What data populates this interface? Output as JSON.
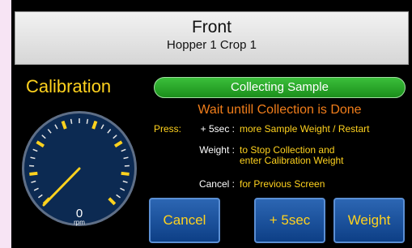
{
  "header": {
    "title": "Front",
    "subtitle": "Hopper 1 Crop 1"
  },
  "calibration": {
    "label": "Calibration"
  },
  "gauge": {
    "value": "0",
    "unit": "rpm",
    "needle_fraction": 0.0
  },
  "status": {
    "label": "Collecting Sample",
    "message": "Wait untill Collection is Done"
  },
  "instructions": {
    "press_label": "Press:",
    "rows": [
      {
        "key": "+ 5sec :",
        "desc": "more Sample Weight / Restart"
      },
      {
        "key": "Weight :",
        "desc": "to Stop Collection and",
        "desc2": "enter Calibration Weight"
      },
      {
        "key": "Cancel :",
        "desc": "for Previous Screen"
      }
    ]
  },
  "buttons": {
    "cancel": "Cancel",
    "plus5": "+ 5sec",
    "weight": "Weight"
  },
  "colors": {
    "accent_yellow": "#ffd21e",
    "status_green": "#2aa52a",
    "warning_orange": "#f07d1a",
    "button_blue": "#1a4f9c",
    "gauge_bg": "#0c2a52"
  }
}
